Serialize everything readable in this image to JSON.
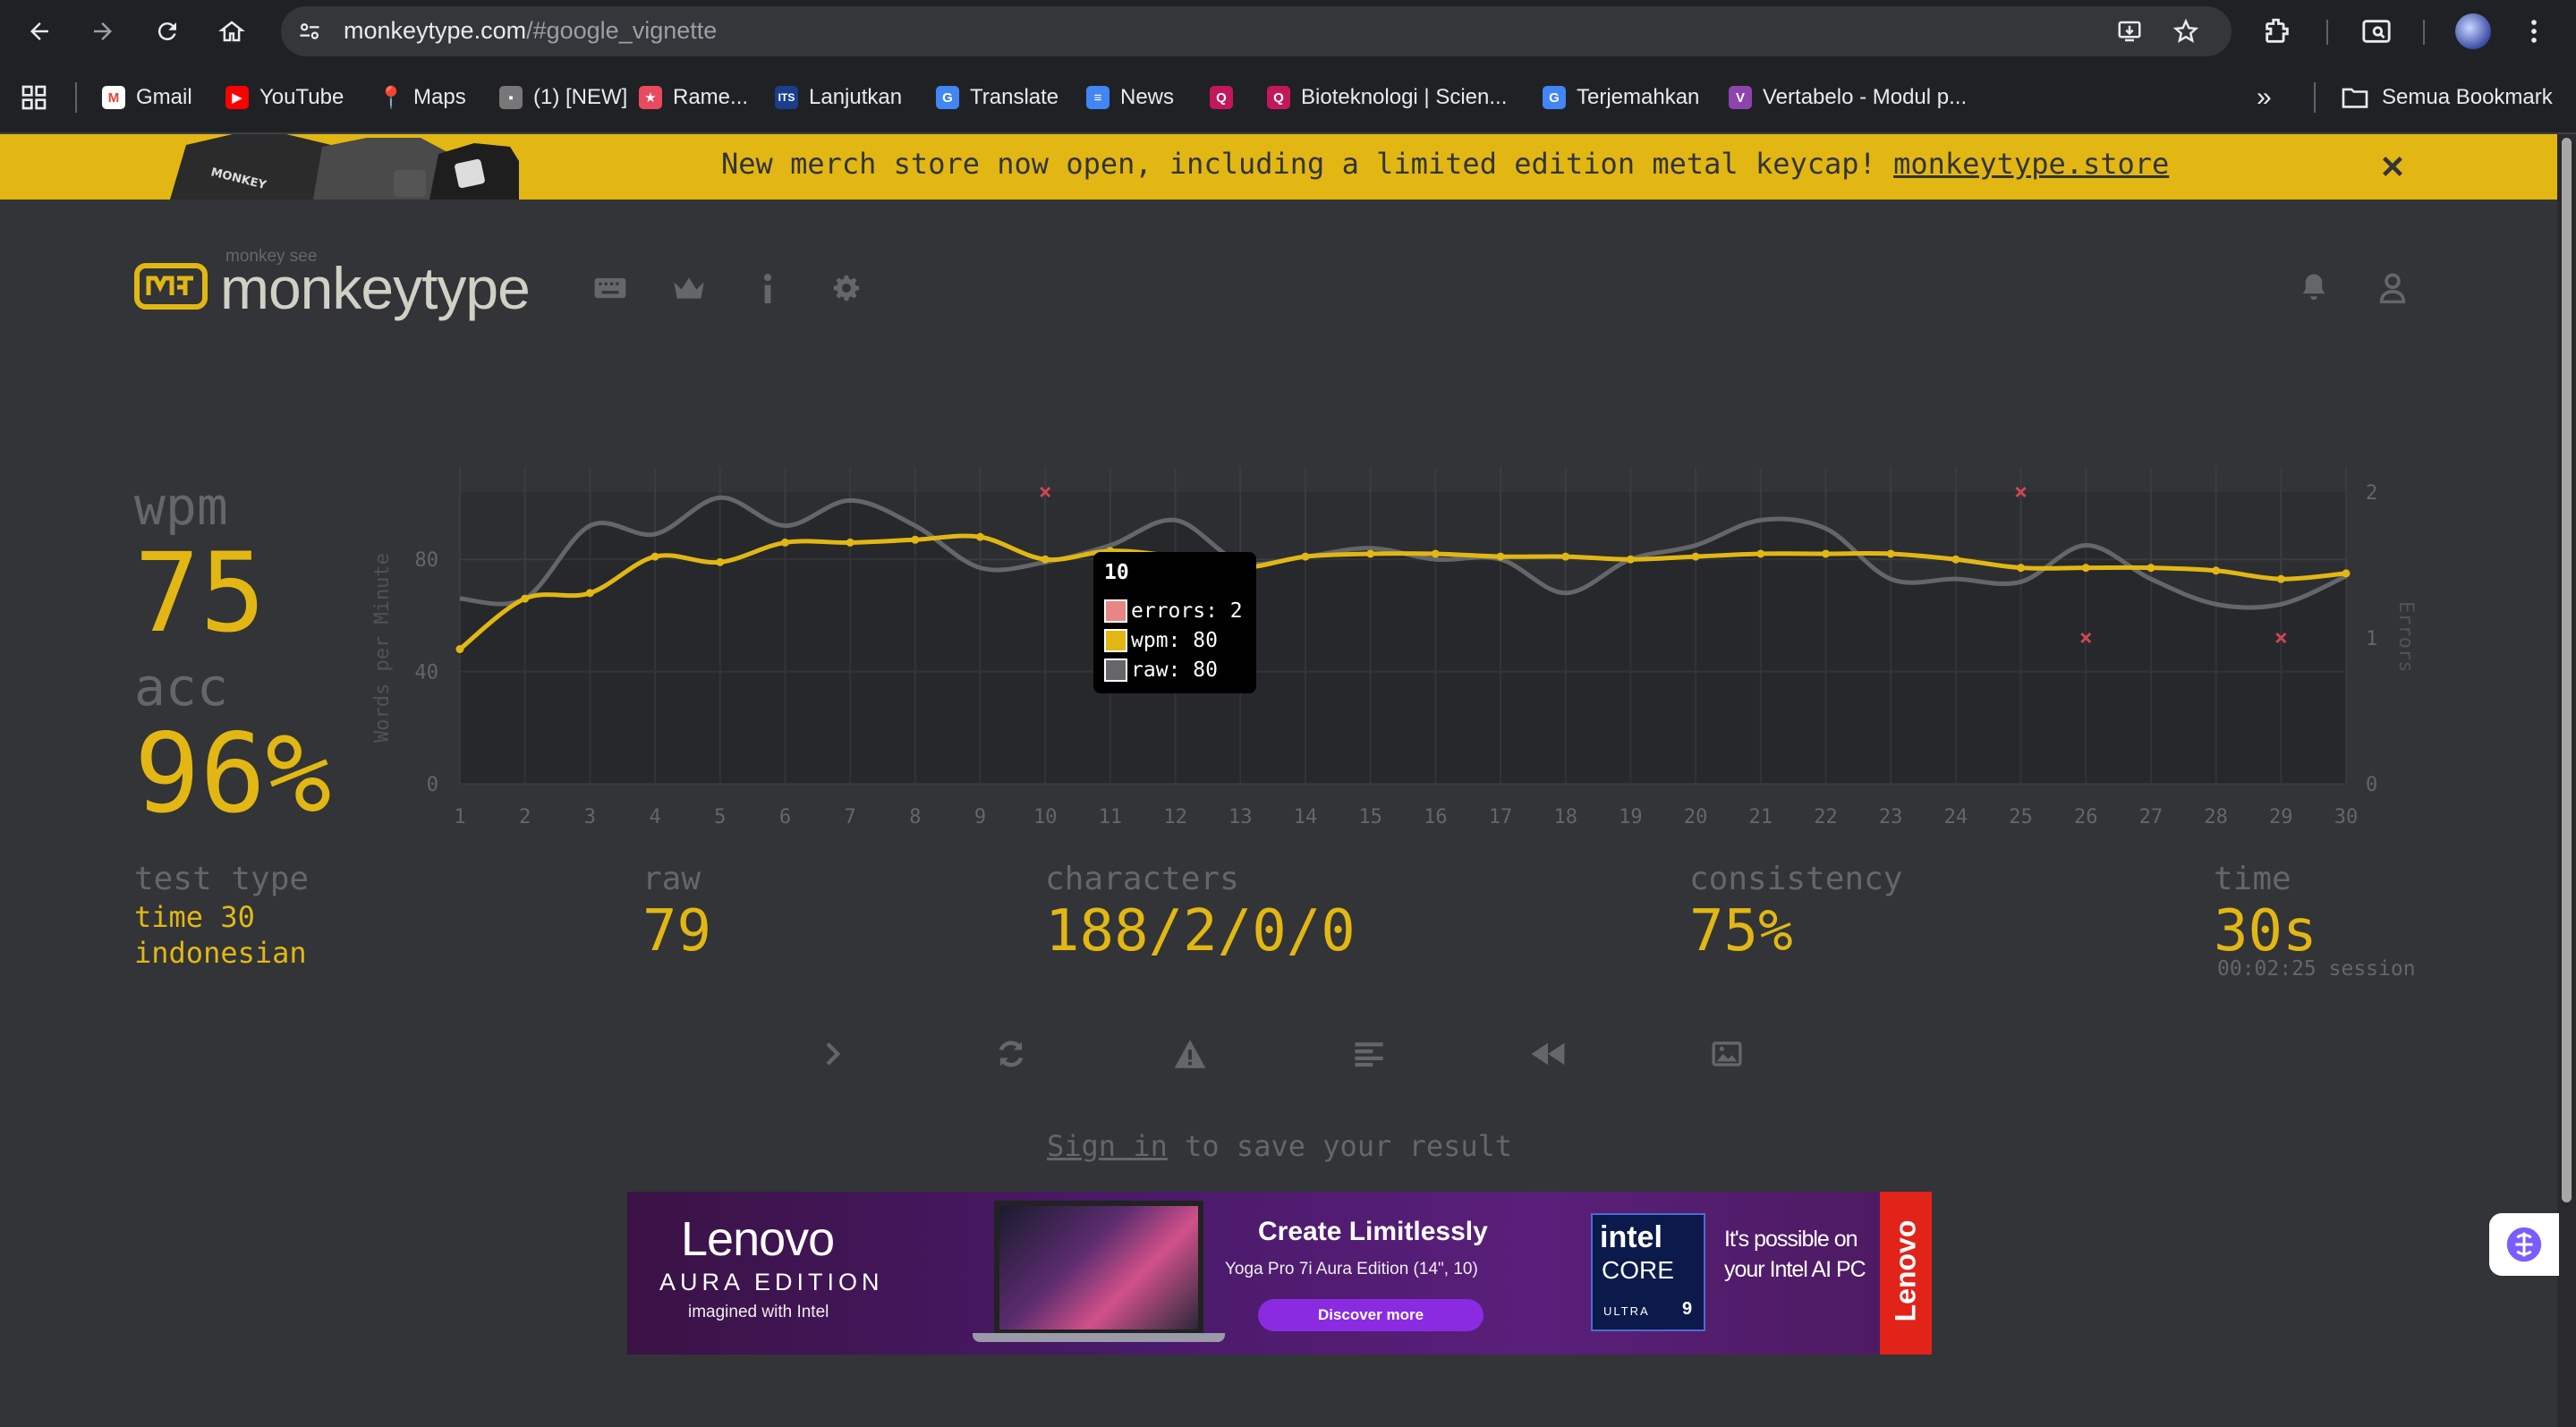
{
  "browser": {
    "url_host": "monkeytype.com",
    "url_path": "/#google_vignette",
    "bookmarks": [
      {
        "label": "Gmail",
        "icon": "gmail-icon",
        "color": "#ea4335"
      },
      {
        "label": "YouTube",
        "icon": "youtube-icon",
        "color": "#ff0000"
      },
      {
        "label": "Maps",
        "icon": "maps-icon",
        "color": "#34a853"
      },
      {
        "label": "(1) [NEW]",
        "icon": "game-icon",
        "color": "#555555"
      },
      {
        "label": "Rame...",
        "icon": "anime-icon",
        "color": "#e84a5f"
      },
      {
        "label": "Lanjutkan",
        "icon": "its-icon",
        "color": "#1a3e8c"
      },
      {
        "label": "Translate",
        "icon": "translate-icon",
        "color": "#4285f4"
      },
      {
        "label": "News",
        "icon": "news-icon",
        "color": "#4285f4"
      },
      {
        "label": "",
        "icon": "quillbot-icon",
        "color": "#c2185b"
      },
      {
        "label": "Bioteknologi | Scien...",
        "icon": "quillbot-icon",
        "color": "#c2185b"
      },
      {
        "label": "Terjemahkan",
        "icon": "translate-icon",
        "color": "#4285f4"
      },
      {
        "label": "Vertabelo - Modul p...",
        "icon": "vertabelo-icon",
        "color": "#8e44ad"
      }
    ],
    "all_bookmarks": "Semua Bookmark"
  },
  "banner": {
    "text": "New merch store now open, including a limited edition metal keycap!",
    "link": "monkeytype.store",
    "image_text": "MONKEY"
  },
  "header": {
    "logo_small": "monkey see",
    "logo": "monkeytype"
  },
  "stats": {
    "wpm_label": "wpm",
    "wpm": "75",
    "acc_label": "acc",
    "acc": "96%",
    "test_type_label": "test type",
    "test_type_mode": "time 30",
    "test_type_language": "indonesian",
    "raw_label": "raw",
    "raw": "79",
    "characters_label": "characters",
    "characters": "188/2/0/0",
    "consistency_label": "consistency",
    "consistency": "75%",
    "time_label": "time",
    "time": "30s",
    "session": "00:02:25 session"
  },
  "chart_data": {
    "type": "line",
    "ylabel": "Words per Minute",
    "y2label": "Errors",
    "ylim": [
      0,
      104
    ],
    "y2lim": [
      0,
      2
    ],
    "yticks": [
      "0",
      "40",
      "80"
    ],
    "y2ticks": [
      "0",
      "1",
      "2"
    ],
    "x": [
      1,
      2,
      3,
      4,
      5,
      6,
      7,
      8,
      9,
      10,
      11,
      12,
      13,
      14,
      15,
      16,
      17,
      18,
      19,
      20,
      21,
      22,
      23,
      24,
      25,
      26,
      27,
      28,
      29,
      30
    ],
    "series": [
      {
        "name": "wpm",
        "color": "#e2b714",
        "values": [
          48,
          66,
          68,
          81,
          79,
          86,
          86,
          87,
          88,
          80,
          83,
          81,
          77,
          81,
          82,
          82,
          81,
          81,
          80,
          81,
          82,
          82,
          82,
          80,
          77,
          77,
          77,
          76,
          73,
          75
        ]
      },
      {
        "name": "raw",
        "color": "#646669",
        "values": [
          66,
          66,
          92,
          89,
          102,
          92,
          101,
          92,
          77,
          79,
          85,
          94,
          79,
          81,
          84,
          80,
          80,
          68,
          80,
          85,
          94,
          91,
          73,
          73,
          72,
          85,
          73,
          64,
          64,
          74
        ]
      },
      {
        "name": "errors",
        "color": "#ca4754",
        "axis": "y2",
        "points": [
          [
            10,
            2
          ],
          [
            25,
            2
          ],
          [
            26,
            1
          ],
          [
            29,
            1
          ]
        ]
      }
    ],
    "tooltip": {
      "title": "10",
      "rows": [
        {
          "label": "errors: 2",
          "color": "#e88585"
        },
        {
          "label": "wpm: 80",
          "color": "#e2b714"
        },
        {
          "label": "raw: 80",
          "color": "#646669"
        }
      ]
    },
    "grid": true,
    "legend": "tooltip"
  },
  "ad": {
    "brand": "Lenovo",
    "edition": "AURA EDITION",
    "tagline": "imagined with Intel",
    "headline": "Create Limitlessly",
    "subline": "Yoga Pro 7i Aura Edition (14\", 10)",
    "cta": "Discover more",
    "chip_brand": "intel",
    "chip_core": "CORE",
    "chip_tier": "ULTRA",
    "chip_num": "9",
    "pitch": "It's possible on your Intel AI PC",
    "side_logo": "Lenovo"
  },
  "footer": {
    "signin_link": "Sign in",
    "signin_rest": "to save your result"
  }
}
